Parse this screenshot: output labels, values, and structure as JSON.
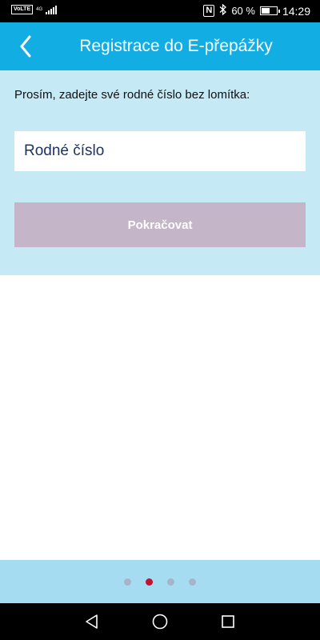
{
  "status_bar": {
    "volte": "VoLTE",
    "network_type": "4G",
    "battery_percent": "60 %",
    "battery_level": 0.6,
    "time": "14:29"
  },
  "header": {
    "title": "Registrace do E-přepážky",
    "back_icon": "chevron-left-icon"
  },
  "form": {
    "instruction": "Prosím, zadejte své rodné číslo bez lomítka:",
    "id_input_placeholder": "Rodné číslo",
    "id_input_value": "",
    "continue_label": "Pokračovat"
  },
  "pager": {
    "total": 4,
    "active_index": 1
  },
  "colors": {
    "header_bg": "#12aee3",
    "panel_bg": "#c5e9f5",
    "button_disabled": "#c4b5c9",
    "pager_bg": "#a5dcf1",
    "dot_active": "#c8102e",
    "dot_inactive": "#a6b3c8"
  }
}
